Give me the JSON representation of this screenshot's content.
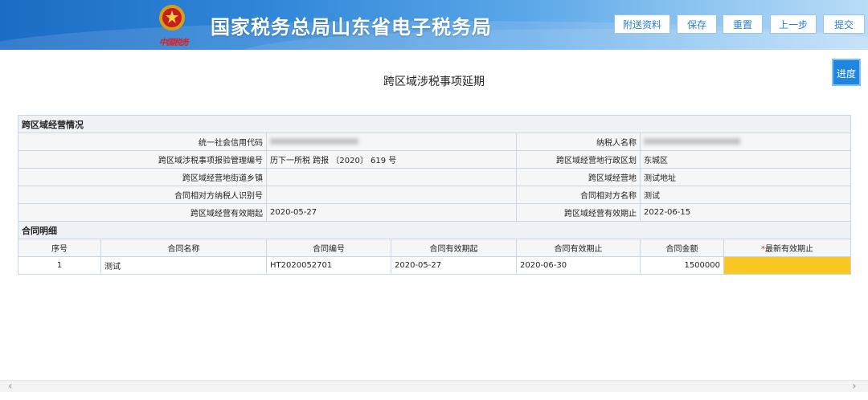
{
  "header": {
    "title": "国家税务总局山东省电子税务局",
    "emblem_caption": "中国税务",
    "buttons": [
      "附送资料",
      "保存",
      "重置",
      "上一步",
      "提交"
    ]
  },
  "progress_label": "进度",
  "page_title": "跨区域涉税事项延期",
  "section1": {
    "title": "跨区域经营情况",
    "rows": [
      {
        "l1": "统一社会信用代码",
        "v1": "",
        "l2": "纳税人名称",
        "v2": ""
      },
      {
        "l1": "跨区域涉税事项报验管理编号",
        "v1": "历下一所税 跨报 〔2020〕 619 号",
        "l2": "跨区域经营地行政区划",
        "v2": "东城区"
      },
      {
        "l1": "跨区域经营地街道乡镇",
        "v1": "",
        "l2": "跨区域经营地",
        "v2": "测试地址"
      },
      {
        "l1": "合同相对方纳税人识别号",
        "v1": "",
        "l2": "合同相对方名称",
        "v2": "测试"
      },
      {
        "l1": "跨区域经营有效期起",
        "v1": "2020-05-27",
        "l2": "跨区域经营有效期止",
        "v2": "2022-06-15"
      }
    ]
  },
  "section2": {
    "title": "合同明细",
    "columns": [
      "序号",
      "合同名称",
      "合同编号",
      "合同有效期起",
      "合同有效期止",
      "合同金额",
      "最新有效期止"
    ],
    "required_mark": "*",
    "rows": [
      {
        "no": "1",
        "name": "测试",
        "code": "HT2020052701",
        "start": "2020-05-27",
        "end": "2020-06-30",
        "amount": "1500000",
        "newend": ""
      }
    ]
  },
  "colors": {
    "header": "#2f86d8",
    "accent": "#1f86e0",
    "highlight": "#f9c823"
  }
}
